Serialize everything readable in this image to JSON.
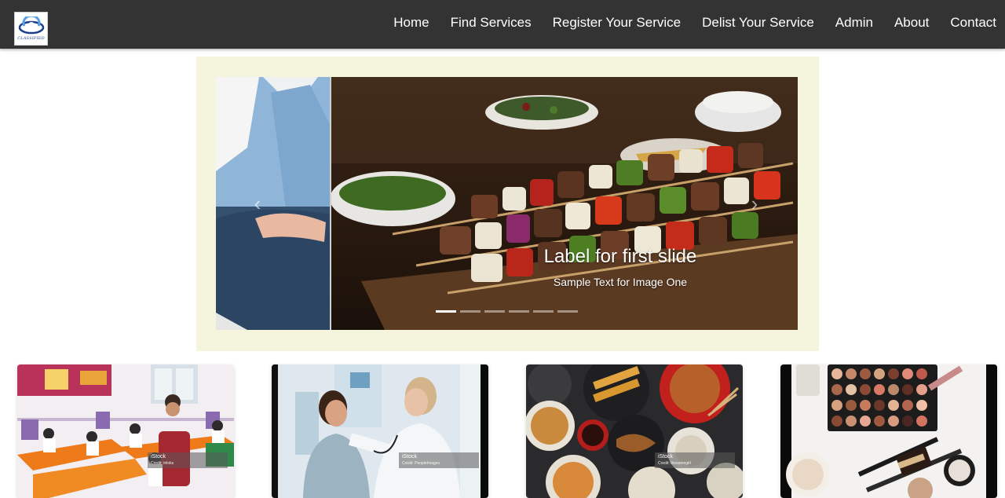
{
  "brand": {
    "logo_text": "CLASSIFIED",
    "colors": {
      "navbar": "#333333",
      "carousel_frame": "#f4f5dc",
      "logo_blue": "#1c3d87"
    }
  },
  "nav": {
    "items": [
      {
        "label": "Home"
      },
      {
        "label": "Find Services"
      },
      {
        "label": "Register Your Service"
      },
      {
        "label": "Delist Your Service"
      },
      {
        "label": "Admin"
      },
      {
        "label": "About"
      },
      {
        "label": "Contact"
      }
    ]
  },
  "carousel": {
    "active_index": 0,
    "slide_count": 6,
    "caption_title": "Label for first slide",
    "caption_text": "Sample Text for Image One",
    "prev_icon": "chevron-left-icon",
    "next_icon": "chevron-right-icon",
    "prev_glyph": "‹",
    "next_glyph": "›"
  },
  "cards": [
    {
      "image": "classroom",
      "watermark": "iStock",
      "credit": "Credit: triloks"
    },
    {
      "image": "doctor-patient",
      "watermark": "iStock",
      "credit": "Credit: PeopleImages"
    },
    {
      "image": "asian-food",
      "watermark": "iStock",
      "credit": "Credit: thesomegirl"
    },
    {
      "image": "makeup",
      "watermark": "",
      "credit": ""
    }
  ]
}
